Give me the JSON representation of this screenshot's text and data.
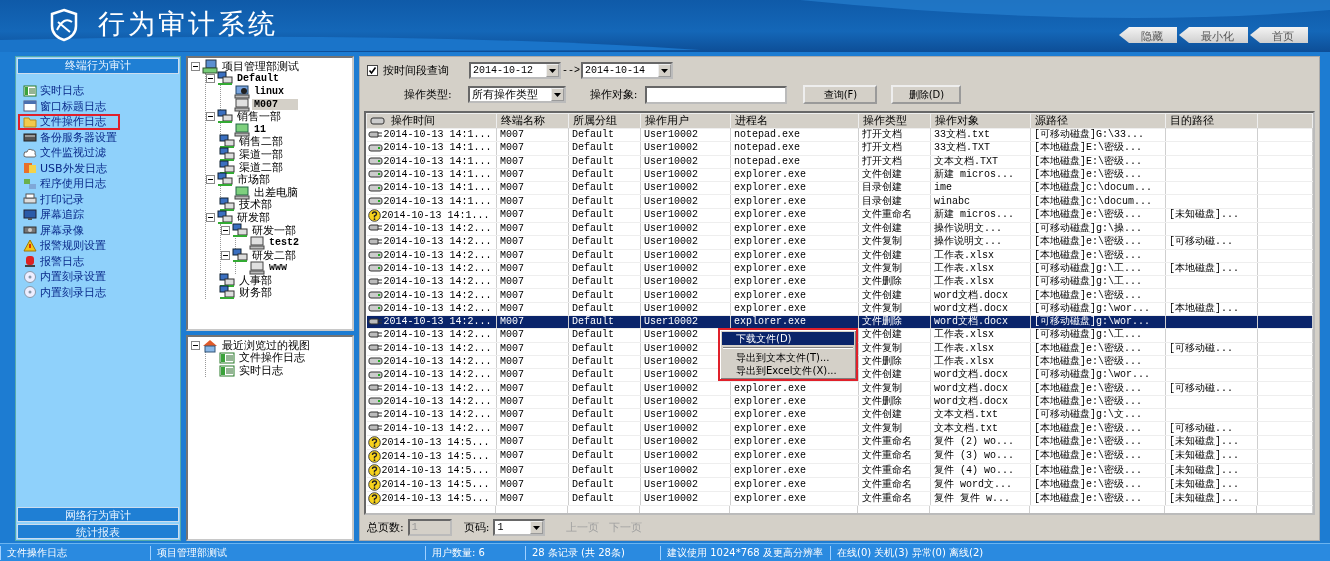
{
  "app": {
    "title": "行为审计系统",
    "window_buttons": [
      "隐藏",
      "最小化",
      "首页"
    ]
  },
  "sidebar": {
    "header": "终端行为审计",
    "items": [
      {
        "label": "实时日志",
        "selected": false
      },
      {
        "label": "窗口标题日志",
        "selected": false
      },
      {
        "label": "文件操作日志",
        "selected": true
      },
      {
        "label": "备份服务器设置",
        "selected": false
      },
      {
        "label": "文件监视过滤",
        "selected": false
      },
      {
        "label": "USB外发日志",
        "selected": false
      },
      {
        "label": "程序使用日志",
        "selected": false
      },
      {
        "label": "打印记录",
        "selected": false
      },
      {
        "label": "屏幕追踪",
        "selected": false
      },
      {
        "label": "屏幕录像",
        "selected": false
      },
      {
        "label": "报警规则设置",
        "selected": false
      },
      {
        "label": "报警日志",
        "selected": false
      },
      {
        "label": "内置刻录设置",
        "selected": false
      },
      {
        "label": "内置刻录日志",
        "selected": false
      }
    ],
    "footer_buttons": [
      "网络行为审计",
      "统计报表"
    ]
  },
  "tree": {
    "nodes": [
      {
        "label": "项目管理部测试",
        "kind": "root",
        "selected": false,
        "children": [
          {
            "label": "Default",
            "kind": "group",
            "selected": false,
            "children": [
              {
                "label": "linux",
                "kind": "linux",
                "selected": false
              },
              {
                "label": "M007",
                "kind": "pc",
                "selected": true
              }
            ]
          },
          {
            "label": "销售一部",
            "kind": "group",
            "selected": false,
            "children": [
              {
                "label": "11",
                "kind": "online",
                "selected": false
              }
            ]
          },
          {
            "label": "销售二部",
            "kind": "group",
            "selected": false
          },
          {
            "label": "渠道一部",
            "kind": "group",
            "selected": false
          },
          {
            "label": "渠道二部",
            "kind": "group",
            "selected": false
          },
          {
            "label": "市场部",
            "kind": "group",
            "selected": false,
            "children": [
              {
                "label": "出差电脑",
                "kind": "online",
                "selected": false
              }
            ]
          },
          {
            "label": "技术部",
            "kind": "group",
            "selected": false
          },
          {
            "label": "研发部",
            "kind": "group",
            "selected": false,
            "children": [
              {
                "label": "研发一部",
                "kind": "group",
                "selected": false,
                "children": [
                  {
                    "label": "test2",
                    "kind": "pc",
                    "selected": false
                  }
                ]
              },
              {
                "label": "研发二部",
                "kind": "group",
                "selected": false,
                "children": [
                  {
                    "label": "www",
                    "kind": "pc",
                    "selected": false
                  }
                ]
              }
            ]
          },
          {
            "label": "人事部",
            "kind": "group",
            "selected": false
          },
          {
            "label": "财务部",
            "kind": "group",
            "selected": false
          }
        ]
      }
    ]
  },
  "recent": {
    "nodes": [
      {
        "label": "最近浏览过的视图",
        "kind": "home",
        "selected": false,
        "children": [
          {
            "label": "文件操作日志",
            "kind": "log",
            "selected": false
          },
          {
            "label": "实时日志",
            "kind": "log",
            "selected": false
          }
        ]
      }
    ]
  },
  "filters": {
    "time_filter": {
      "label": "按时间段查询",
      "checked": true
    },
    "date_from": "2014-10-12",
    "arrow": "-->",
    "date_to": "2014-10-14",
    "type_label": "操作类型:",
    "type_value": "所有操作类型",
    "object_label": "操作对象:",
    "buttons": [
      "查询(F)",
      "删除(D)"
    ]
  },
  "table": {
    "columns": [
      "操作时间",
      "终端名称",
      "所属分组",
      "操作用户",
      "进程名",
      "操作类型",
      "操作对象",
      "源路径",
      "目的路径"
    ],
    "rows": [
      {
        "kind": "usb",
        "selected": false,
        "cells": [
          "2014-10-13 14:1...",
          "M007",
          "Default",
          "User10002",
          "notepad.exe",
          "打开文档",
          "33文档.txt",
          "[可移动磁盘]G:\\33...",
          ""
        ]
      },
      {
        "kind": "disk",
        "selected": false,
        "cells": [
          "2014-10-13 14:1...",
          "M007",
          "Default",
          "User10002",
          "notepad.exe",
          "打开文档",
          "33文档.TXT",
          "[本地磁盘]E:\\密级...",
          ""
        ]
      },
      {
        "kind": "disk",
        "selected": false,
        "cells": [
          "2014-10-13 14:1...",
          "M007",
          "Default",
          "User10002",
          "notepad.exe",
          "打开文档",
          "文本文档.TXT",
          "[本地磁盘]E:\\密级...",
          ""
        ]
      },
      {
        "kind": "disk",
        "selected": false,
        "cells": [
          "2014-10-13 14:1...",
          "M007",
          "Default",
          "User10002",
          "explorer.exe",
          "文件创建",
          "新建 micros...",
          "[本地磁盘]e:\\密级...",
          ""
        ]
      },
      {
        "kind": "disk",
        "selected": false,
        "cells": [
          "2014-10-13 14:1...",
          "M007",
          "Default",
          "User10002",
          "explorer.exe",
          "目录创建",
          "ime",
          "[本地磁盘]c:\\docum...",
          ""
        ]
      },
      {
        "kind": "disk",
        "selected": false,
        "cells": [
          "2014-10-13 14:1...",
          "M007",
          "Default",
          "User10002",
          "explorer.exe",
          "目录创建",
          "winabc",
          "[本地磁盘]c:\\docum...",
          ""
        ]
      },
      {
        "kind": "unknown",
        "selected": false,
        "cells": [
          "2014-10-13 14:1...",
          "M007",
          "Default",
          "User10002",
          "explorer.exe",
          "文件重命名",
          "新建 micros...",
          "[本地磁盘]e:\\密级...",
          "[未知磁盘]..."
        ]
      },
      {
        "kind": "usb",
        "selected": false,
        "cells": [
          "2014-10-13 14:2...",
          "M007",
          "Default",
          "User10002",
          "explorer.exe",
          "文件创建",
          "操作说明文...",
          "[可移动磁盘]g:\\操...",
          ""
        ]
      },
      {
        "kind": "usb",
        "selected": false,
        "cells": [
          "2014-10-13 14:2...",
          "M007",
          "Default",
          "User10002",
          "explorer.exe",
          "文件复制",
          "操作说明文...",
          "[本地磁盘]e:\\密级...",
          "[可移动磁..."
        ]
      },
      {
        "kind": "disk",
        "selected": false,
        "cells": [
          "2014-10-13 14:2...",
          "M007",
          "Default",
          "User10002",
          "explorer.exe",
          "文件创建",
          "工作表.xlsx",
          "[本地磁盘]e:\\密级...",
          ""
        ]
      },
      {
        "kind": "disk",
        "selected": false,
        "cells": [
          "2014-10-13 14:2...",
          "M007",
          "Default",
          "User10002",
          "explorer.exe",
          "文件复制",
          "工作表.xlsx",
          "[可移动磁盘]g:\\工...",
          "[本地磁盘]..."
        ]
      },
      {
        "kind": "usb",
        "selected": false,
        "cells": [
          "2014-10-13 14:2...",
          "M007",
          "Default",
          "User10002",
          "explorer.exe",
          "文件删除",
          "工作表.xlsx",
          "[可移动磁盘]g:\\工...",
          ""
        ]
      },
      {
        "kind": "disk",
        "selected": false,
        "cells": [
          "2014-10-13 14:2...",
          "M007",
          "Default",
          "User10002",
          "explorer.exe",
          "文件创建",
          "word文档.docx",
          "[本地磁盘]e:\\密级...",
          ""
        ]
      },
      {
        "kind": "disk",
        "selected": false,
        "cells": [
          "2014-10-13 14:2...",
          "M007",
          "Default",
          "User10002",
          "explorer.exe",
          "文件复制",
          "word文档.docx",
          "[可移动磁盘]g:\\wor...",
          "[本地磁盘]..."
        ]
      },
      {
        "kind": "usb",
        "selected": true,
        "cells": [
          "2014-10-13 14:2...",
          "M007",
          "Default",
          "User10002",
          "explorer.exe",
          "文件删除",
          "word文档.docx",
          "[可移动磁盘]g:\\wor...",
          ""
        ]
      },
      {
        "kind": "usb",
        "selected": false,
        "cells": [
          "2014-10-13 14:2...",
          "M007",
          "Default",
          "User10002",
          "",
          "文件创建",
          "工作表.xlsx",
          "[可移动磁盘]g:\\工...",
          ""
        ]
      },
      {
        "kind": "usb",
        "selected": false,
        "cells": [
          "2014-10-13 14:2...",
          "M007",
          "Default",
          "User10002",
          "",
          "文件复制",
          "工作表.xlsx",
          "[本地磁盘]e:\\密级...",
          "[可移动磁..."
        ]
      },
      {
        "kind": "disk",
        "selected": false,
        "cells": [
          "2014-10-13 14:2...",
          "M007",
          "Default",
          "User10002",
          "",
          "文件删除",
          "工作表.xlsx",
          "[本地磁盘]e:\\密级...",
          ""
        ]
      },
      {
        "kind": "disk",
        "selected": false,
        "cells": [
          "2014-10-13 14:2...",
          "M007",
          "Default",
          "User10002",
          "",
          "文件创建",
          "word文档.docx",
          "[可移动磁盘]g:\\wor...",
          ""
        ]
      },
      {
        "kind": "usb",
        "selected": false,
        "cells": [
          "2014-10-13 14:2...",
          "M007",
          "Default",
          "User10002",
          "explorer.exe",
          "文件复制",
          "word文档.docx",
          "[本地磁盘]e:\\密级...",
          "[可移动磁..."
        ]
      },
      {
        "kind": "disk",
        "selected": false,
        "cells": [
          "2014-10-13 14:2...",
          "M007",
          "Default",
          "User10002",
          "explorer.exe",
          "文件删除",
          "word文档.docx",
          "[本地磁盘]e:\\密级...",
          ""
        ]
      },
      {
        "kind": "usb",
        "selected": false,
        "cells": [
          "2014-10-13 14:2...",
          "M007",
          "Default",
          "User10002",
          "explorer.exe",
          "文件创建",
          "文本文档.txt",
          "[可移动磁盘]g:\\文...",
          ""
        ]
      },
      {
        "kind": "usb",
        "selected": false,
        "cells": [
          "2014-10-13 14:2...",
          "M007",
          "Default",
          "User10002",
          "explorer.exe",
          "文件复制",
          "文本文档.txt",
          "[本地磁盘]e:\\密级...",
          "[可移动磁..."
        ]
      },
      {
        "kind": "unknown",
        "selected": false,
        "cells": [
          "2014-10-13 14:5...",
          "M007",
          "Default",
          "User10002",
          "explorer.exe",
          "文件重命名",
          "复件 (2) wo...",
          "[本地磁盘]e:\\密级...",
          "[未知磁盘]..."
        ]
      },
      {
        "kind": "unknown",
        "selected": false,
        "cells": [
          "2014-10-13 14:5...",
          "M007",
          "Default",
          "User10002",
          "explorer.exe",
          "文件重命名",
          "复件 (3) wo...",
          "[本地磁盘]e:\\密级...",
          "[未知磁盘]..."
        ]
      },
      {
        "kind": "unknown",
        "selected": false,
        "cells": [
          "2014-10-13 14:5...",
          "M007",
          "Default",
          "User10002",
          "explorer.exe",
          "文件重命名",
          "复件 (4) wo...",
          "[本地磁盘]e:\\密级...",
          "[未知磁盘]..."
        ]
      },
      {
        "kind": "unknown",
        "selected": false,
        "cells": [
          "2014-10-13 14:5...",
          "M007",
          "Default",
          "User10002",
          "explorer.exe",
          "文件重命名",
          "复件 word文...",
          "[本地磁盘]e:\\密级...",
          "[未知磁盘]..."
        ]
      },
      {
        "kind": "unknown",
        "selected": false,
        "cells": [
          "2014-10-13 14:5...",
          "M007",
          "Default",
          "User10002",
          "explorer.exe",
          "文件重命名",
          "复件 复件 w...",
          "[本地磁盘]e:\\密级...",
          "[未知磁盘]..."
        ]
      }
    ]
  },
  "context_menu": {
    "items": [
      {
        "kind": "item",
        "label": "下载文件(D)",
        "selected": true
      },
      {
        "kind": "separator"
      },
      {
        "kind": "item",
        "label": "导出到文本文件(T)...",
        "selected": false
      },
      {
        "kind": "item",
        "label": "导出到Excel文件(X)...",
        "selected": false
      }
    ]
  },
  "pager": {
    "total_label": "总页数:",
    "total_value": "1",
    "page_label": "页码:",
    "page_value": "1",
    "buttons": [
      {
        "label": "上一页",
        "disabled": true
      },
      {
        "label": "下一页",
        "disabled": true
      }
    ]
  },
  "status_bar": [
    "文件操作日志",
    "项目管理部测试",
    "用户数量: 6",
    "28 条记录 (共 28条)",
    "建议使用 1024*768 及更高分辨率",
    "在线(0) 关机(3) 异常(0) 离线(2)"
  ]
}
